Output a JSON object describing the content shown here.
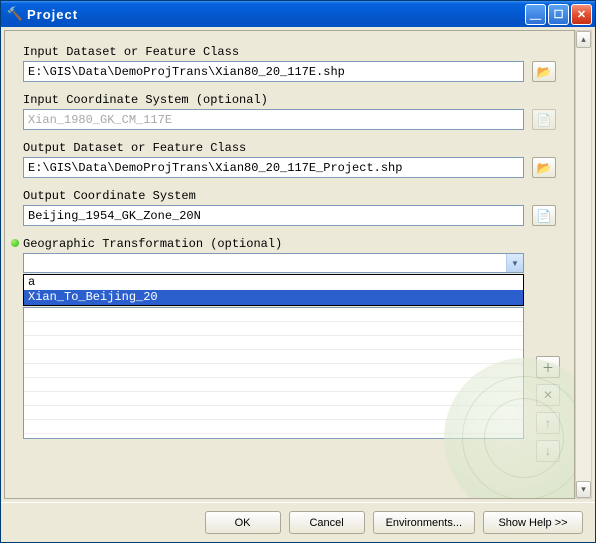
{
  "window": {
    "title": "Project"
  },
  "fields": {
    "input_dataset": {
      "label": "Input Dataset or Feature Class",
      "value": "E:\\GIS\\Data\\DemoProjTrans\\Xian80_20_117E.shp"
    },
    "input_cs": {
      "label": "Input Coordinate System (optional)",
      "value": "Xian_1980_GK_CM_117E"
    },
    "output_dataset": {
      "label": "Output Dataset or Feature Class",
      "value": "E:\\GIS\\Data\\DemoProjTrans\\Xian80_20_117E_Project.shp"
    },
    "output_cs": {
      "label": "Output Coordinate System",
      "value": "Beijing_1954_GK_Zone_20N"
    },
    "geotrans": {
      "label": "Geographic Transformation (optional)",
      "value": "",
      "options": [
        "a",
        "Xian_To_Beijing_20"
      ]
    }
  },
  "buttons": {
    "ok": "OK",
    "cancel": "Cancel",
    "env": "Environments...",
    "help": "Show Help >>"
  },
  "icons": {
    "browse": "📂",
    "props": "📄",
    "add": "＋",
    "delete": "✕",
    "up": "↑",
    "down": "↓",
    "hammer": "🔨",
    "dd": "▼",
    "su": "▴",
    "sd": "▾",
    "min": "＿",
    "max": "☐",
    "close": "✕"
  }
}
